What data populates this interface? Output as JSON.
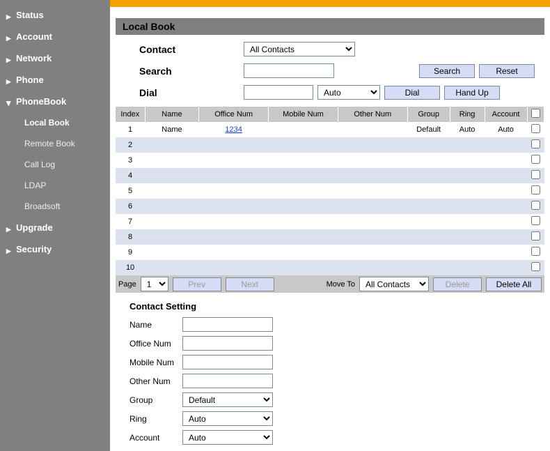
{
  "sidebar": {
    "items": [
      {
        "label": "Status",
        "expanded": false
      },
      {
        "label": "Account",
        "expanded": false
      },
      {
        "label": "Network",
        "expanded": false
      },
      {
        "label": "Phone",
        "expanded": false
      },
      {
        "label": "PhoneBook",
        "expanded": true,
        "children": [
          {
            "label": "Local Book",
            "active": true
          },
          {
            "label": "Remote Book"
          },
          {
            "label": "Call Log"
          },
          {
            "label": "LDAP"
          },
          {
            "label": "Broadsoft"
          }
        ]
      },
      {
        "label": "Upgrade",
        "expanded": false
      },
      {
        "label": "Security",
        "expanded": false
      }
    ]
  },
  "panel": {
    "title": "Local Book"
  },
  "filter": {
    "contact_label": "Contact",
    "contact_value": "All Contacts",
    "search_label": "Search",
    "search_value": "",
    "search_btn": "Search",
    "reset_btn": "Reset",
    "dial_label": "Dial",
    "dial_value": "",
    "dial_mode": "Auto",
    "dial_btn": "Dial",
    "handup_btn": "Hand Up"
  },
  "table": {
    "headers": {
      "index": "Index",
      "name": "Name",
      "office": "Office Num",
      "mobile": "Mobile Num",
      "other": "Other Num",
      "group": "Group",
      "ring": "Ring",
      "account": "Account"
    },
    "rows": [
      {
        "index": "1",
        "name": "Name",
        "office": "1234",
        "mobile": "",
        "other": "",
        "group": "Default",
        "ring": "Auto",
        "account": "Auto"
      },
      {
        "index": "2"
      },
      {
        "index": "3"
      },
      {
        "index": "4"
      },
      {
        "index": "5"
      },
      {
        "index": "6"
      },
      {
        "index": "7"
      },
      {
        "index": "8"
      },
      {
        "index": "9"
      },
      {
        "index": "10"
      }
    ]
  },
  "pager": {
    "page_label": "Page",
    "page_value": "1",
    "prev": "Prev",
    "next": "Next",
    "moveto": "Move To",
    "moveto_value": "All Contacts",
    "delete": "Delete",
    "delete_all": "Delete All"
  },
  "contact_setting": {
    "title": "Contact Setting",
    "name_label": "Name",
    "name_value": "",
    "office_label": "Office Num",
    "office_value": "",
    "mobile_label": "Mobile Num",
    "mobile_value": "",
    "other_label": "Other Num",
    "other_value": "",
    "group_label": "Group",
    "group_value": "Default",
    "ring_label": "Ring",
    "ring_value": "Auto",
    "account_label": "Account",
    "account_value": "Auto"
  }
}
